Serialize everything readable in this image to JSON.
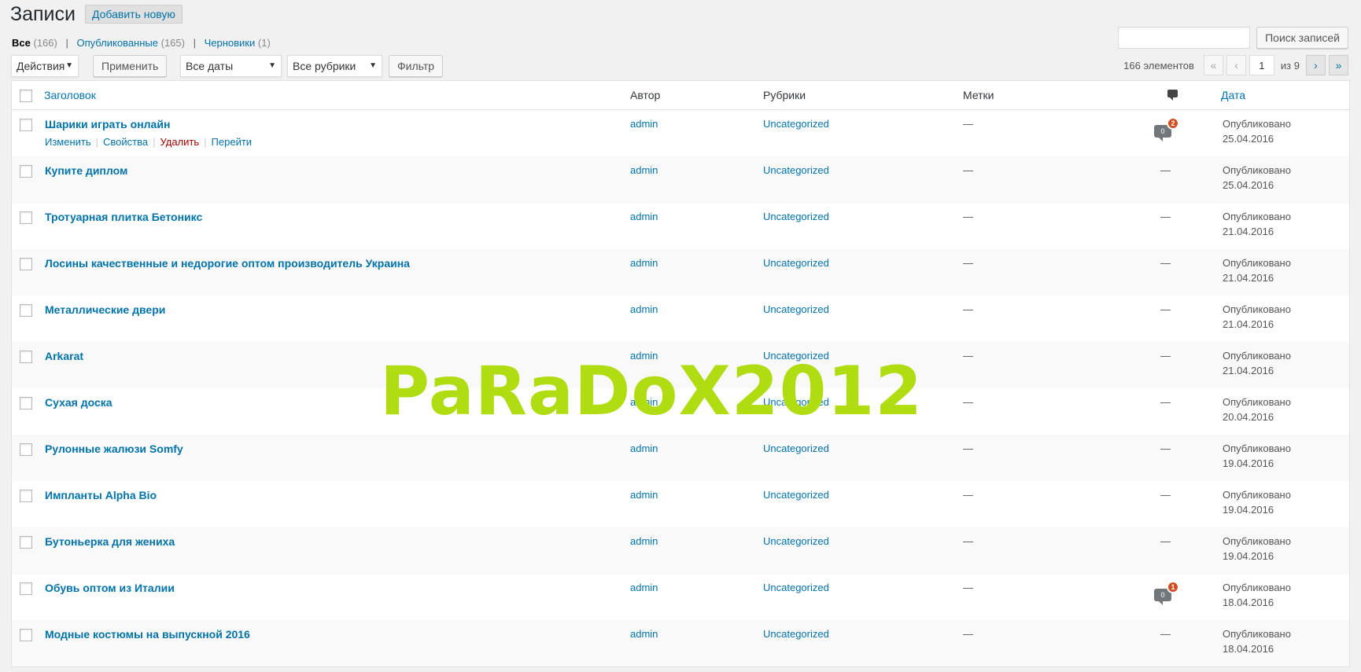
{
  "header": {
    "title": "Записи",
    "add_new": "Добавить новую"
  },
  "views": [
    {
      "label": "Все",
      "count": "(166)"
    },
    {
      "label": "Опубликованные",
      "count": "(165)"
    },
    {
      "label": "Черновики",
      "count": "(1)"
    }
  ],
  "search": {
    "button": "Поиск записей",
    "value": ""
  },
  "bulk": {
    "action": "Действия",
    "apply": "Применить"
  },
  "filters": {
    "dates": "Все даты",
    "categories": "Все рубрики",
    "filter_button": "Фильтр"
  },
  "pagination": {
    "items": "166 элементов",
    "first": "«",
    "prev": "‹",
    "current": "1",
    "of": "из 9",
    "next": "›",
    "last": "»"
  },
  "columns": {
    "title": "Заголовок",
    "author": "Автор",
    "categories": "Рубрики",
    "tags": "Метки",
    "date": "Дата"
  },
  "row_actions": {
    "edit": "Изменить",
    "quick_edit": "Свойства",
    "trash": "Удалить",
    "view": "Перейти"
  },
  "posts": [
    {
      "title": "Шарики играть онлайн",
      "author": "admin",
      "category": "Uncategorized",
      "tags": "—",
      "comments": "0",
      "pending": "2",
      "status": "Опубликовано",
      "date": "25.04.2016"
    },
    {
      "title": "Купите диплом",
      "author": "admin",
      "category": "Uncategorized",
      "tags": "—",
      "comments": "—",
      "pending": "",
      "status": "Опубликовано",
      "date": "25.04.2016"
    },
    {
      "title": "Тротуарная плитка Бетоникс",
      "author": "admin",
      "category": "Uncategorized",
      "tags": "—",
      "comments": "—",
      "pending": "",
      "status": "Опубликовано",
      "date": "21.04.2016"
    },
    {
      "title": "Лосины качественные и недорогие оптом производитель Украина",
      "author": "admin",
      "category": "Uncategorized",
      "tags": "—",
      "comments": "—",
      "pending": "",
      "status": "Опубликовано",
      "date": "21.04.2016"
    },
    {
      "title": "Металлические двери",
      "author": "admin",
      "category": "Uncategorized",
      "tags": "—",
      "comments": "—",
      "pending": "",
      "status": "Опубликовано",
      "date": "21.04.2016"
    },
    {
      "title": "Arkarat",
      "author": "admin",
      "category": "Uncategorized",
      "tags": "—",
      "comments": "—",
      "pending": "",
      "status": "Опубликовано",
      "date": "21.04.2016"
    },
    {
      "title": "Сухая доска",
      "author": "admin",
      "category": "Uncategorized",
      "tags": "—",
      "comments": "—",
      "pending": "",
      "status": "Опубликовано",
      "date": "20.04.2016"
    },
    {
      "title": "Рулонные жалюзи Somfy",
      "author": "admin",
      "category": "Uncategorized",
      "tags": "—",
      "comments": "—",
      "pending": "",
      "status": "Опубликовано",
      "date": "19.04.2016"
    },
    {
      "title": "Импланты Alpha Bio",
      "author": "admin",
      "category": "Uncategorized",
      "tags": "—",
      "comments": "—",
      "pending": "",
      "status": "Опубликовано",
      "date": "19.04.2016"
    },
    {
      "title": "Бутоньерка для жениха",
      "author": "admin",
      "category": "Uncategorized",
      "tags": "—",
      "comments": "—",
      "pending": "",
      "status": "Опубликовано",
      "date": "19.04.2016"
    },
    {
      "title": "Обувь оптом из Италии",
      "author": "admin",
      "category": "Uncategorized",
      "tags": "—",
      "comments": "0",
      "pending": "1",
      "status": "Опубликовано",
      "date": "18.04.2016"
    },
    {
      "title": "Модные костюмы на выпускной 2016",
      "author": "admin",
      "category": "Uncategorized",
      "tags": "—",
      "comments": "—",
      "pending": "",
      "status": "Опубликовано",
      "date": "18.04.2016"
    }
  ],
  "watermark": "PaRaDoX2012"
}
